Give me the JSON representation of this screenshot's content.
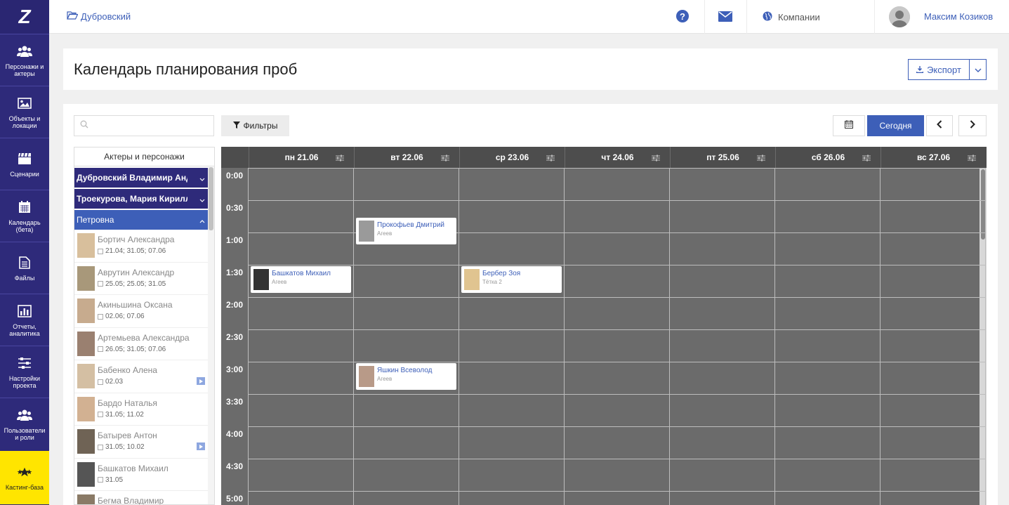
{
  "nav": {
    "items": [
      {
        "name": "nav-characters-actors",
        "label": "Персонажи и актеры",
        "icon": "users-icon"
      },
      {
        "name": "nav-objects-locations",
        "label": "Объекты и локации",
        "icon": "image-icon"
      },
      {
        "name": "nav-scenarios",
        "label": "Сценарии",
        "icon": "clapperboard-icon"
      },
      {
        "name": "nav-calendar",
        "label": "Календарь (бета)",
        "icon": "calendar-icon"
      },
      {
        "name": "nav-files",
        "label": "Файлы",
        "icon": "file-icon"
      },
      {
        "name": "nav-reports",
        "label": "Отчеты, аналитика",
        "icon": "bar-chart-icon"
      },
      {
        "name": "nav-project-settings",
        "label": "Настройки проекта",
        "icon": "sliders-icon"
      },
      {
        "name": "nav-users-roles",
        "label": "Пользователи и роли",
        "icon": "users-icon"
      }
    ],
    "casting": {
      "label": "Кастинг-база",
      "icon": "stars-icon"
    }
  },
  "topbar": {
    "project": "Дубровский",
    "companies": "Компании",
    "user": "Максим Козиков"
  },
  "page": {
    "title": "Календарь планирования проб",
    "export_label": "Экспорт"
  },
  "toolbar": {
    "search_placeholder": "",
    "filters_label": "Фильтры",
    "today_label": "Сегодня"
  },
  "actors_panel": {
    "header": "Актеры и персонажи",
    "characters": [
      {
        "label": "Дубровский Владимир Андреевич",
        "active": false
      },
      {
        "label": "Троекурова, Мария Кирилловна",
        "active": false
      },
      {
        "label": "Петровна",
        "active": true
      }
    ],
    "actors": [
      {
        "name": "Бортич Александра",
        "dates": "21.04; 31.05; 07.06",
        "video": false
      },
      {
        "name": "Аврутин Александр",
        "dates": "25.05; 25.05; 31.05",
        "video": false
      },
      {
        "name": "Акиньшина Оксана",
        "dates": "02.06; 07.06",
        "video": false
      },
      {
        "name": "Артемьева Александра",
        "dates": "26.05; 31.05; 07.06",
        "video": false
      },
      {
        "name": "Бабенко Алена",
        "dates": "02.03",
        "video": true
      },
      {
        "name": "Бардо Наталья",
        "dates": "31.05; 11.02",
        "video": false
      },
      {
        "name": "Батырев Антон",
        "dates": "31.05; 10.02",
        "video": true
      },
      {
        "name": "Башкатов Михаил",
        "dates": "31.05",
        "video": false
      },
      {
        "name": "Бегма Владимир",
        "dates": "",
        "video": false
      }
    ]
  },
  "calendar": {
    "days": [
      "пн 21.06",
      "вт 22.06",
      "ср 23.06",
      "чт 24.06",
      "пт 25.06",
      "сб 26.06",
      "вс 27.06"
    ],
    "times": [
      "0:00",
      "0:30",
      "1:00",
      "1:30",
      "2:00",
      "2:30",
      "3:00",
      "3:30",
      "4:00",
      "4:30",
      "5:00"
    ],
    "events": [
      {
        "day": 1,
        "slot": 1.5,
        "name": "Прокофьев Дмитрий",
        "role": "Агеев"
      },
      {
        "day": 0,
        "slot": 3,
        "name": "Башкатов Михаил",
        "role": "Агеев"
      },
      {
        "day": 2,
        "slot": 3,
        "name": "Бербер Зоя",
        "role": "Тётка 2"
      },
      {
        "day": 1,
        "slot": 6,
        "name": "Яшкин Всеволод",
        "role": "Агеев"
      }
    ]
  },
  "colors": {
    "brand": "#2e2a7a",
    "accent": "#3d5fb8",
    "casting": "#ffe500",
    "grid": "#6b6b6b"
  }
}
